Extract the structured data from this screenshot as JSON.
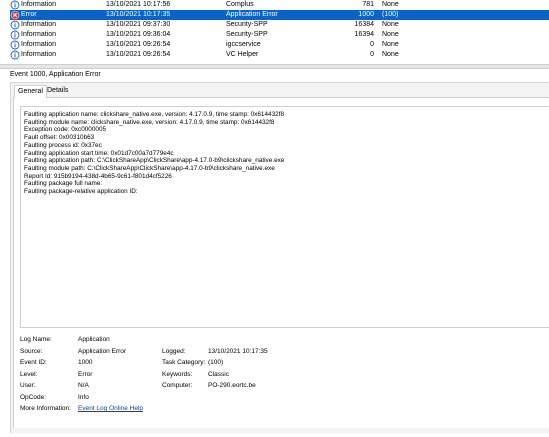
{
  "events": {
    "rows": [
      {
        "level": "Information",
        "date": "13/10/2021 10:17:56",
        "source": "Complus",
        "id": "781",
        "category": "None",
        "type": "info",
        "selected": false,
        "partial": false
      },
      {
        "level": "Error",
        "date": "13/10/2021 10:17:35",
        "source": "Application Error",
        "id": "1000",
        "category": "(100)",
        "type": "error",
        "selected": true,
        "partial": false
      },
      {
        "level": "Information",
        "date": "13/10/2021 09:37:30",
        "source": "Security-SPP",
        "id": "16384",
        "category": "None",
        "type": "info",
        "selected": false,
        "partial": false
      },
      {
        "level": "Information",
        "date": "13/10/2021 09:36:04",
        "source": "Security-SPP",
        "id": "16394",
        "category": "None",
        "type": "info",
        "selected": false,
        "partial": false
      },
      {
        "level": "Information",
        "date": "13/10/2021 09:26:54",
        "source": "igccservice",
        "id": "0",
        "category": "None",
        "type": "info",
        "selected": false,
        "partial": false
      },
      {
        "level": "Information",
        "date": "13/10/2021 09:26:54",
        "source": "VC Helper",
        "id": "0",
        "category": "None",
        "type": "info",
        "selected": false,
        "partial": false
      }
    ]
  },
  "detail": {
    "title": "Event 1000, Application Error",
    "tabs": {
      "general": "General",
      "details": "Details"
    },
    "message_lines": [
      "Faulting application name: clickshare_native.exe, version: 4.17.0.9, time stamp: 0x614432f8",
      "Faulting module name: clickshare_native.exe, version: 4.17.0.9, time stamp: 0x614432f8",
      "Exception code: 0xc0000005",
      "Fault offset: 0x00310b63",
      "Faulting process id: 0x37ec",
      "Faulting application start time: 0x01d7c00a7d779e4c",
      "Faulting application path: C:\\ClickShareApp\\ClickShare\\app-4.17.0-b9\\clickshare_native.exe",
      "Faulting module path: C:\\ClickShareApp\\ClickShare\\app-4.17.0-b9\\clickshare_native.exe",
      "Report Id: 915b9194-438d-4b65-9c61-f801d4cf5226",
      "Faulting package full name:",
      "Faulting package-relative application ID:"
    ],
    "props": {
      "log_name_label": "Log Name:",
      "log_name": "Application",
      "source_label": "Source:",
      "source": "Application Error",
      "logged_label": "Logged:",
      "logged": "13/10/2021 10:17:35",
      "event_id_label": "Event ID:",
      "event_id": "1000",
      "task_category_label": "Task Category:",
      "task_category": "(100)",
      "level_label": "Level:",
      "level": "Error",
      "keywords_label": "Keywords:",
      "keywords": "Classic",
      "user_label": "User:",
      "user": "N/A",
      "computer_label": "Computer:",
      "computer": "PO-290.eortc.be",
      "opcode_label": "OpCode:",
      "opcode": "Info",
      "more_info_label": "More Information:",
      "more_info_link": "Event Log Online Help"
    }
  },
  "colors": {
    "selection": "#0a64c8",
    "info_icon": "#1e5fb4",
    "error_icon": "#d13438"
  }
}
